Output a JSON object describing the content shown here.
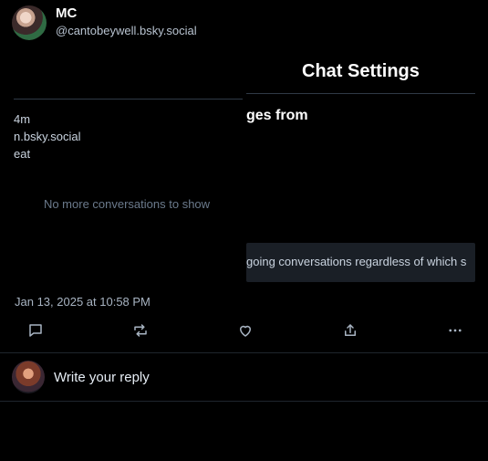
{
  "post": {
    "author_name": "MC",
    "author_handle": "@cantobeywell.bsky.social",
    "timestamp": "Jan 13, 2025 at 10:58 PM"
  },
  "left_panel": {
    "line1": "4m",
    "line2": "n.bsky.social",
    "line3": "eat",
    "empty_text": "No more conversations to show"
  },
  "settings_panel": {
    "title": "Chat Settings",
    "heading": "ges from",
    "option_text": "going conversations regardless of which s"
  },
  "actions": {
    "reply_icon": "reply-icon",
    "repost_icon": "repost-icon",
    "like_icon": "like-icon",
    "share_icon": "share-icon",
    "more_icon": "more-icon"
  },
  "reply": {
    "placeholder": "Write your reply"
  },
  "colors": {
    "background": "#000000",
    "muted_text": "#a8b4c2",
    "divider": "#1f252d"
  }
}
